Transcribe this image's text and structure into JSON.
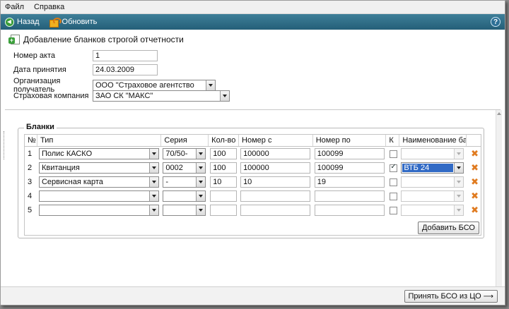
{
  "menu": {
    "file": "Файл",
    "help": "Справка"
  },
  "toolbar": {
    "back": "Назад",
    "refresh": "Обновить",
    "help_glyph": "?"
  },
  "page": {
    "title": "Добавление бланков строгой отчетности"
  },
  "form": {
    "act_number": {
      "label": "Номер акта",
      "value": "1"
    },
    "accept_date": {
      "label": "Дата принятия",
      "value": "24.03.2009"
    },
    "recipient_org": {
      "label": "Организация получатель",
      "value": "ООО \"Страховое агентство"
    },
    "insurance_company": {
      "label": "Страховая компания",
      "value": "ЗАО СК \"МАКС\""
    }
  },
  "blanks": {
    "legend": "Бланки",
    "columns": [
      "№",
      "Тип",
      "Серия",
      "Кол-во",
      "Номер с",
      "Номер по",
      "К",
      "Наименование банка"
    ],
    "rows": [
      {
        "n": "1",
        "type": "Полис КАСКО",
        "series": "70/50-",
        "qty": "100",
        "from": "100000",
        "to": "100099",
        "k": false,
        "bank": ""
      },
      {
        "n": "2",
        "type": "Квитанция",
        "series": "0002",
        "qty": "100",
        "from": "100000",
        "to": "100099",
        "k": true,
        "bank": "ВТБ 24"
      },
      {
        "n": "3",
        "type": "Сервисная карта",
        "series": "-",
        "qty": "10",
        "from": "10",
        "to": "19",
        "k": false,
        "bank": ""
      },
      {
        "n": "4",
        "type": "",
        "series": "",
        "qty": "",
        "from": "",
        "to": "",
        "k": false,
        "bank": ""
      },
      {
        "n": "5",
        "type": "",
        "series": "",
        "qty": "",
        "from": "",
        "to": "",
        "k": false,
        "bank": ""
      }
    ],
    "add_button": "Добавить БСО"
  },
  "footer": {
    "accept_button": "Принять БСО из ЦО",
    "accept_arrow": "⟶"
  },
  "colors": {
    "toolbar": "#2e6c86",
    "delete": "#e07b20",
    "selection": "#316ac5"
  }
}
